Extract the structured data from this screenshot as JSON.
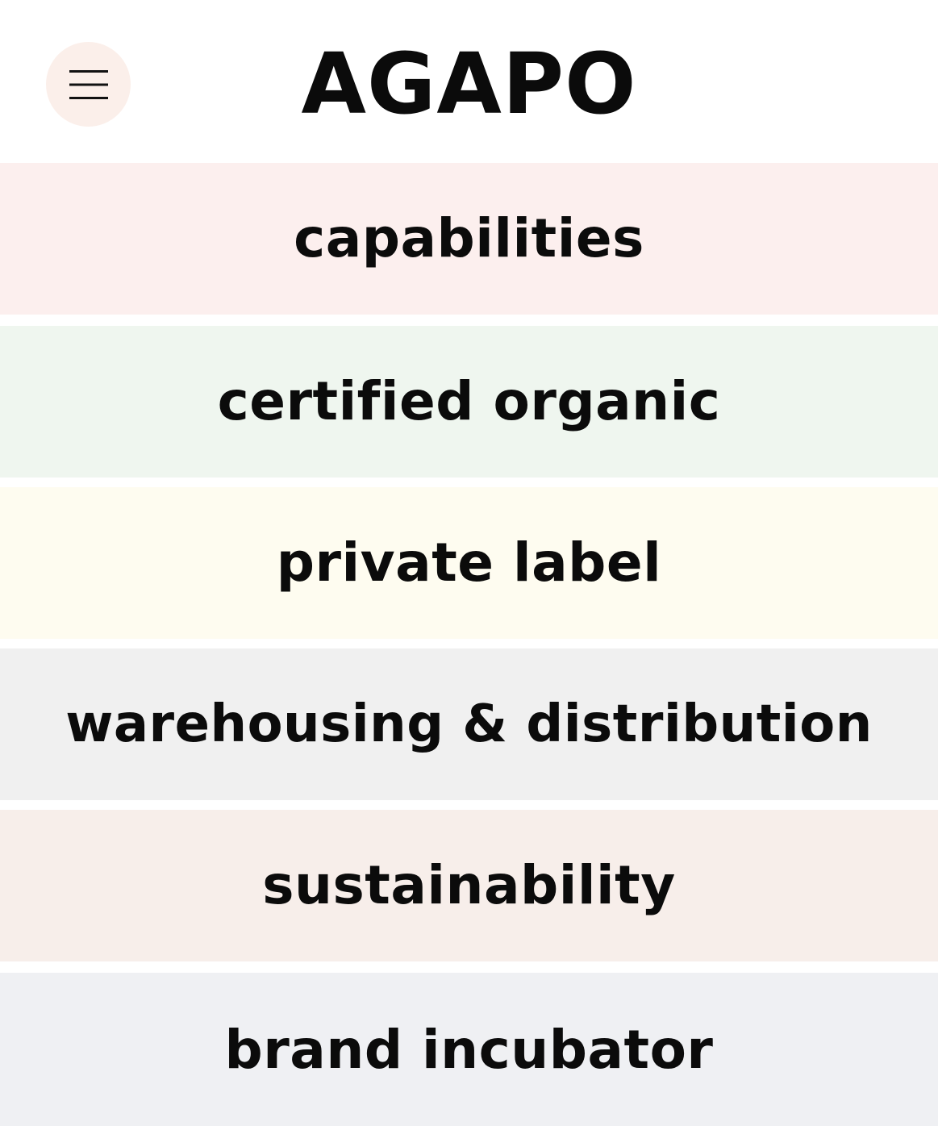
{
  "header": {
    "brand": "AGAPO",
    "menu_button_icon": "hamburger-menu-icon"
  },
  "nav": {
    "items": [
      {
        "label": "capabilities",
        "color": "#fcefee"
      },
      {
        "label": "certified organic",
        "color": "#eff6ef"
      },
      {
        "label": "private label",
        "color": "#fefcf0"
      },
      {
        "label": "warehousing & distribution",
        "color": "#f0f0f0"
      },
      {
        "label": "sustainability",
        "color": "#f7eeea"
      },
      {
        "label": "brand incubator",
        "color": "#eff0f3"
      }
    ]
  },
  "colors": {
    "menu_button_bg": "#fbefea",
    "text": "#0b0b0b"
  }
}
